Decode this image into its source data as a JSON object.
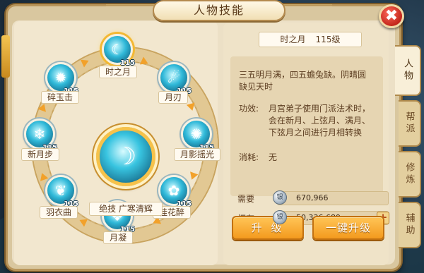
{
  "title": "人物技能",
  "close_icon": "✖",
  "wheel": {
    "center": {
      "label": "绝技  广寒清辉",
      "icon": "moon-spirit-icon"
    },
    "skills": [
      {
        "name": "时之月",
        "level": "115",
        "icon": "crescent-icon",
        "selected": true
      },
      {
        "name": "月刃",
        "level": "115",
        "icon": "blade-icon"
      },
      {
        "name": "月影摇光",
        "level": "115",
        "icon": "moonlight-icon"
      },
      {
        "name": "桂花醉",
        "level": "115",
        "icon": "osmanthus-icon"
      },
      {
        "name": "月凝",
        "level": "115",
        "icon": "crystal-icon"
      },
      {
        "name": "羽衣曲",
        "level": "115",
        "icon": "feather-icon"
      },
      {
        "name": "新月步",
        "level": "115",
        "icon": "new-moon-icon"
      },
      {
        "name": "碎玉击",
        "level": "115",
        "icon": "jade-icon"
      }
    ]
  },
  "detail": {
    "name": "时之月",
    "level": "115级",
    "poem": "三五明月满，四五蟾兔缺。阴晴圆缺见天时",
    "effect_label": "功效:",
    "effect": "月宫弟子使用门派法术时，会在新月、上弦月、满月、下弦月之间进行月相转换",
    "cost_label": "消耗:",
    "cost": "无"
  },
  "resources": {
    "need_label": "需要",
    "need_value": "670,966",
    "have_label": "拥有",
    "have_value": "50,336,689",
    "coin_icon": "silver-coin-icon",
    "coin_text": "银",
    "plus": "+"
  },
  "buttons": {
    "upgrade": "升 级",
    "upgrade_all": "一键升级"
  },
  "tabs": [
    "人物",
    "帮派",
    "修炼",
    "辅助"
  ],
  "colors": {
    "accent": "#f39a1e",
    "panel": "#ece0c6",
    "border": "#b8955a"
  }
}
